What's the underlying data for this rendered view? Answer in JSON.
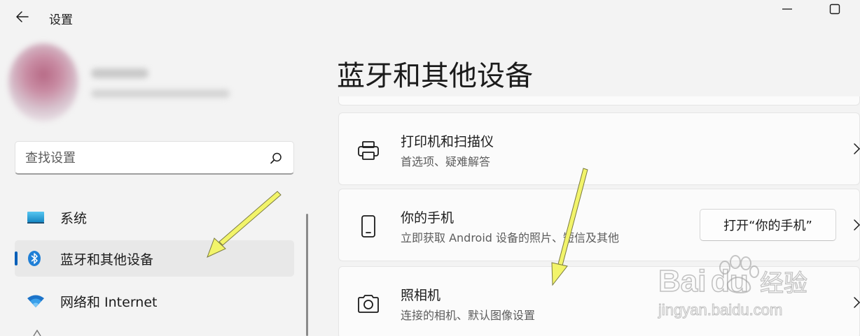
{
  "window": {
    "title": "设置",
    "back_icon": "back-arrow-icon",
    "minimize_icon": "minimize-icon",
    "maximize_icon": "maximize-icon"
  },
  "search": {
    "placeholder": "查找设置",
    "icon": "search-icon"
  },
  "sidebar": {
    "items": [
      {
        "label": "系统",
        "icon": "display-icon",
        "selected": false
      },
      {
        "label": "蓝牙和其他设备",
        "icon": "bluetooth-icon",
        "selected": true
      },
      {
        "label": "网络和 Internet",
        "icon": "wifi-icon",
        "selected": false
      }
    ]
  },
  "main": {
    "title": "蓝牙和其他设备",
    "cards": [
      {
        "title": "打印机和扫描仪",
        "description": "首选项、疑难解答",
        "icon": "printer-icon"
      },
      {
        "title": "你的手机",
        "description": "立即获取 Android 设备的照片、短信及其他",
        "icon": "phone-icon",
        "button_label": "打开“你的手机”"
      },
      {
        "title": "照相机",
        "description": "连接的相机、默认图像设置",
        "icon": "camera-icon"
      }
    ]
  },
  "watermark": {
    "brand_text": "Bai",
    "brand_text2": "du",
    "brand_cn": "经验",
    "url": "jingyan.baidu.com"
  },
  "colors": {
    "accent": "#005fb8",
    "annotation_arrow": "#f2f46a",
    "background": "#f3f3f3",
    "card": "#fbfbfb"
  }
}
